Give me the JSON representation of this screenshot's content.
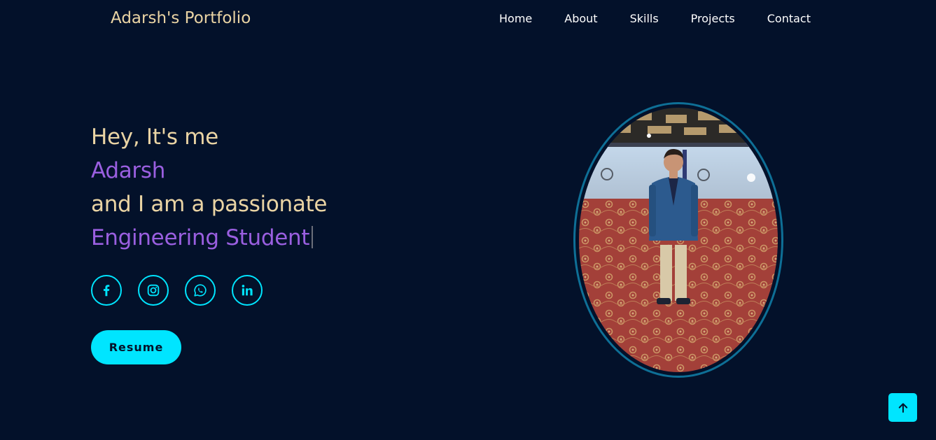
{
  "navbar": {
    "brand": "Adarsh's Portfolio",
    "links": [
      "Home",
      "About",
      "Skills",
      "Projects",
      "Contact"
    ]
  },
  "hero": {
    "greeting": "Hey, It's me",
    "name": "Adarsh",
    "intro": "and I am a passionate",
    "role": "Engineering Student"
  },
  "socials": [
    {
      "icon": "facebook-icon"
    },
    {
      "icon": "instagram-icon"
    },
    {
      "icon": "whatsapp-icon"
    },
    {
      "icon": "linkedin-icon"
    }
  ],
  "resume_label": "Resume",
  "scroll_top_icon": "arrow-up-icon",
  "colors": {
    "background": "#03112a",
    "accent": "#00e5ff",
    "cream": "#ead4a4",
    "purple": "#9a5fe0",
    "frame": "#0e6f96"
  }
}
